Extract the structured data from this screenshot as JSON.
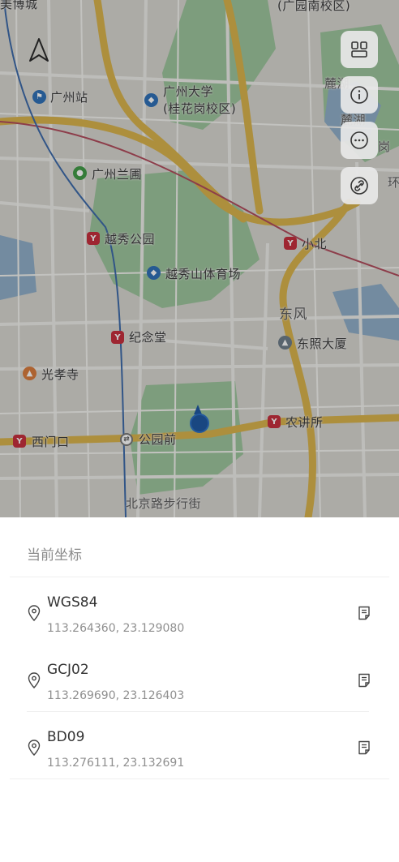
{
  "map": {
    "labels": {
      "gz_station": "广州站",
      "gz_univ": "广州大学",
      "gz_univ_campus": "(桂花岗校区)",
      "lanpu": "广州兰圃",
      "yuexiu_park": "越秀公园",
      "yuexiu_stadium": "越秀山体育场",
      "xiaobei": "小北",
      "dongfeng": "东风",
      "memorial_hall": "纪念堂",
      "dongzhao": "东照大厦",
      "guangxiao": "光孝寺",
      "ximenkou": "西门口",
      "gongyuanqian": "公园前",
      "nongjiangsuo": "农讲所",
      "beijing_road": "北京路步行街",
      "top_left": "美博城",
      "top_right": "(广园南校区)",
      "lulake": "麓湖",
      "xiaolu": "麓湖",
      "right_cut": "岗",
      "right_cut2": "环"
    },
    "icons": [
      "compass-icon",
      "layers-icon",
      "info-icon",
      "more-icon",
      "link-icon"
    ]
  },
  "panel": {
    "title": "当前坐标",
    "items": [
      {
        "name": "WGS84",
        "coords": "113.264360, 23.129080"
      },
      {
        "name": "GCJ02",
        "coords": "113.269690, 23.126403"
      },
      {
        "name": "BD09",
        "coords": "113.276111, 23.132691"
      }
    ]
  },
  "colors": {
    "metro": "#c62c3a",
    "location": "#1b56a0",
    "road_major": "#d9b24a"
  }
}
